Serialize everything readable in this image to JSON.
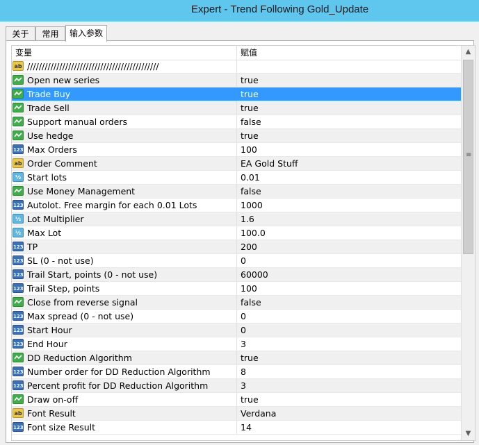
{
  "window": {
    "title": "Expert - Trend Following Gold_Update"
  },
  "tabs": [
    {
      "label": "关于"
    },
    {
      "label": "常用"
    },
    {
      "label": "输入参数"
    }
  ],
  "table": {
    "columns": {
      "variable": "变量",
      "value": "赋值"
    },
    "selected_row": 2,
    "rows": [
      {
        "type": "string",
        "name": "/////////////////////////////////////////////",
        "value": ""
      },
      {
        "type": "bool",
        "name": "Open new series",
        "value": "true"
      },
      {
        "type": "bool",
        "name": "Trade Buy",
        "value": "true"
      },
      {
        "type": "bool",
        "name": "Trade Sell",
        "value": "true"
      },
      {
        "type": "bool",
        "name": "Support manual orders",
        "value": "false"
      },
      {
        "type": "bool",
        "name": "Use hedge",
        "value": "true"
      },
      {
        "type": "int",
        "name": "Max Orders",
        "value": "100"
      },
      {
        "type": "string",
        "name": "Order Comment",
        "value": "EA Gold Stuff"
      },
      {
        "type": "double",
        "name": "Start lots",
        "value": "0.01"
      },
      {
        "type": "bool",
        "name": "Use Money Management",
        "value": "false"
      },
      {
        "type": "int",
        "name": "Autolot. Free margin for each 0.01 Lots",
        "value": "1000"
      },
      {
        "type": "double",
        "name": "Lot Multiplier",
        "value": "1.6"
      },
      {
        "type": "double",
        "name": "Max Lot",
        "value": "100.0"
      },
      {
        "type": "int",
        "name": "TP",
        "value": "200"
      },
      {
        "type": "int",
        "name": "SL (0 - not use)",
        "value": "0"
      },
      {
        "type": "int",
        "name": "Trail Start, points (0 - not use)",
        "value": "60000"
      },
      {
        "type": "int",
        "name": "Trail Step, points",
        "value": "100"
      },
      {
        "type": "bool",
        "name": "Close from reverse signal",
        "value": "false"
      },
      {
        "type": "int",
        "name": "Max spread (0 - not use)",
        "value": "0"
      },
      {
        "type": "int",
        "name": "Start Hour",
        "value": "0"
      },
      {
        "type": "int",
        "name": "End Hour",
        "value": "3"
      },
      {
        "type": "bool",
        "name": "DD Reduction Algorithm",
        "value": "true"
      },
      {
        "type": "int",
        "name": "Number order for DD Reduction Algorithm",
        "value": "8"
      },
      {
        "type": "int",
        "name": "Percent profit for DD Reduction Algorithm",
        "value": "3"
      },
      {
        "type": "bool",
        "name": "Draw on-off",
        "value": "true"
      },
      {
        "type": "string",
        "name": "Font Result",
        "value": "Verdana"
      },
      {
        "type": "int",
        "name": "Font size Result",
        "value": "14"
      }
    ]
  },
  "icons": {
    "int": "123",
    "string": "ab",
    "double": "½"
  },
  "scrollbar": {
    "up": "▲",
    "down": "▼",
    "grip": "≡"
  },
  "colors": {
    "titlebar": "#5fc6ee",
    "selection": "#3399ff"
  }
}
